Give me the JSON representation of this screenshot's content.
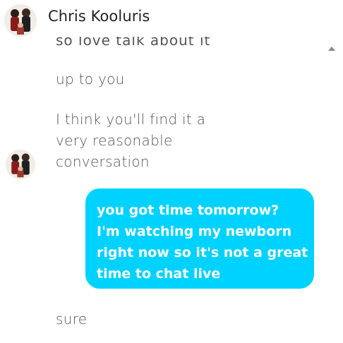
{
  "header": {
    "contact_name": "Chris Kooluris"
  },
  "conversation": {
    "clipped_previous": "so love talk about it",
    "incoming_1": "up to you",
    "incoming_2_lines": [
      "I think you'll find it a",
      "very reasonable",
      "conversation"
    ],
    "outgoing_1_lines": [
      "you got time tomorrow?",
      "I'm watching my newborn",
      "right now so it's not a great",
      "time to chat live"
    ],
    "incoming_3": "sure"
  },
  "icons": {
    "header_avatar": "avatar-photo-icon",
    "message_avatar": "avatar-photo-icon",
    "scroll": "scroll-up-arrow-icon"
  },
  "colors": {
    "outgoing_bubble": "#00d2ff",
    "incoming_text": "#555555",
    "name_text": "#222222"
  }
}
